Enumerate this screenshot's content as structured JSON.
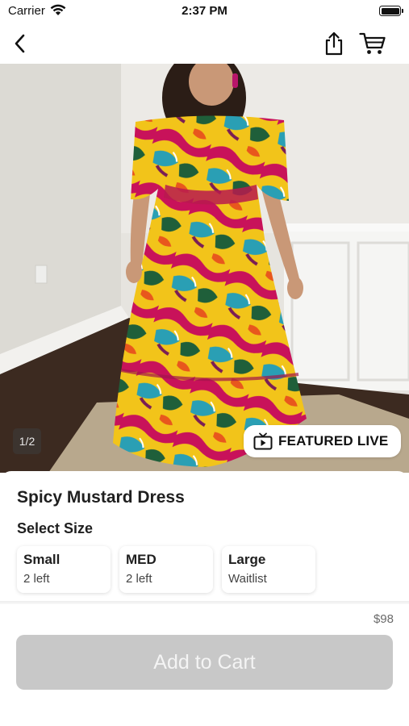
{
  "status_bar": {
    "carrier": "Carrier",
    "time": "2:37 PM"
  },
  "nav": {
    "back_icon": "chevron-left-icon",
    "share_icon": "share-icon",
    "cart_icon": "cart-icon"
  },
  "gallery": {
    "page_indicator": "1/2",
    "badge_icon": "tv-play-icon",
    "badge_label": "FEATURED LIVE"
  },
  "product": {
    "title": "Spicy Mustard Dress",
    "select_size_label": "Select Size",
    "sizes": [
      {
        "name": "Small",
        "stock": "2 left"
      },
      {
        "name": "MED",
        "stock": "2 left"
      },
      {
        "name": "Large",
        "stock": "Waitlist"
      }
    ],
    "price": "$98",
    "add_to_cart_label": "Add to Cart"
  },
  "colors": {
    "button_disabled": "#c8c8c8",
    "dress_yellow": "#f2c41a",
    "dress_magenta": "#c8125a",
    "dress_teal": "#2a9fb4"
  }
}
